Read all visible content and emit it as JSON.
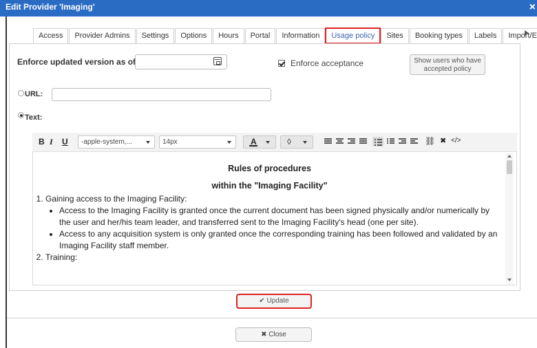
{
  "dialog": {
    "title": "Edit Provider 'Imaging'",
    "close_glyph": "×"
  },
  "tabs": [
    {
      "label": "Access"
    },
    {
      "label": "Provider Admins"
    },
    {
      "label": "Settings"
    },
    {
      "label": "Options"
    },
    {
      "label": "Hours"
    },
    {
      "label": "Portal"
    },
    {
      "label": "Information"
    },
    {
      "label": "Usage policy",
      "active": true
    },
    {
      "label": "Sites"
    },
    {
      "label": "Booking types"
    },
    {
      "label": "Labels"
    },
    {
      "label": "Import/Export"
    }
  ],
  "enforce": {
    "label": "Enforce updated version as of:",
    "date_value": "",
    "acceptance_label": "Enforce acceptance",
    "acceptance_checked": true,
    "show_users_label_line1": "Show users who have",
    "show_users_label_line2": "accepted policy"
  },
  "source": {
    "url_label": "URL:",
    "url_value": "",
    "text_label": "Text:",
    "selected": "text"
  },
  "toolbar": {
    "bold": "B",
    "italic": "I",
    "underline": "U",
    "font_family": "-apple-system,...",
    "font_size": "14px",
    "text_color_glyph": "A",
    "fill_glyph": "◊",
    "link_glyph": "⛓",
    "clear_glyph": "✖",
    "code_glyph": "</>"
  },
  "content": {
    "heading1": "Rules of procedures",
    "heading2": "within the \"Imaging Facility\"",
    "items": [
      {
        "text": "Gaining access to the Imaging Facility:",
        "sub": [
          "Access to the Imaging Facility is granted once the current document has been signed physically and/or numerically by the user and her/his team leader, and transferred sent to the Imaging Facility's head (one per site).",
          "Access to any acquisition system is only granted once the corresponding training has been followed and validated by an Imaging Facility staff member."
        ]
      },
      {
        "text": "Training:",
        "sub": []
      }
    ]
  },
  "buttons": {
    "update": "✔ Update",
    "close": "✖ Close"
  }
}
